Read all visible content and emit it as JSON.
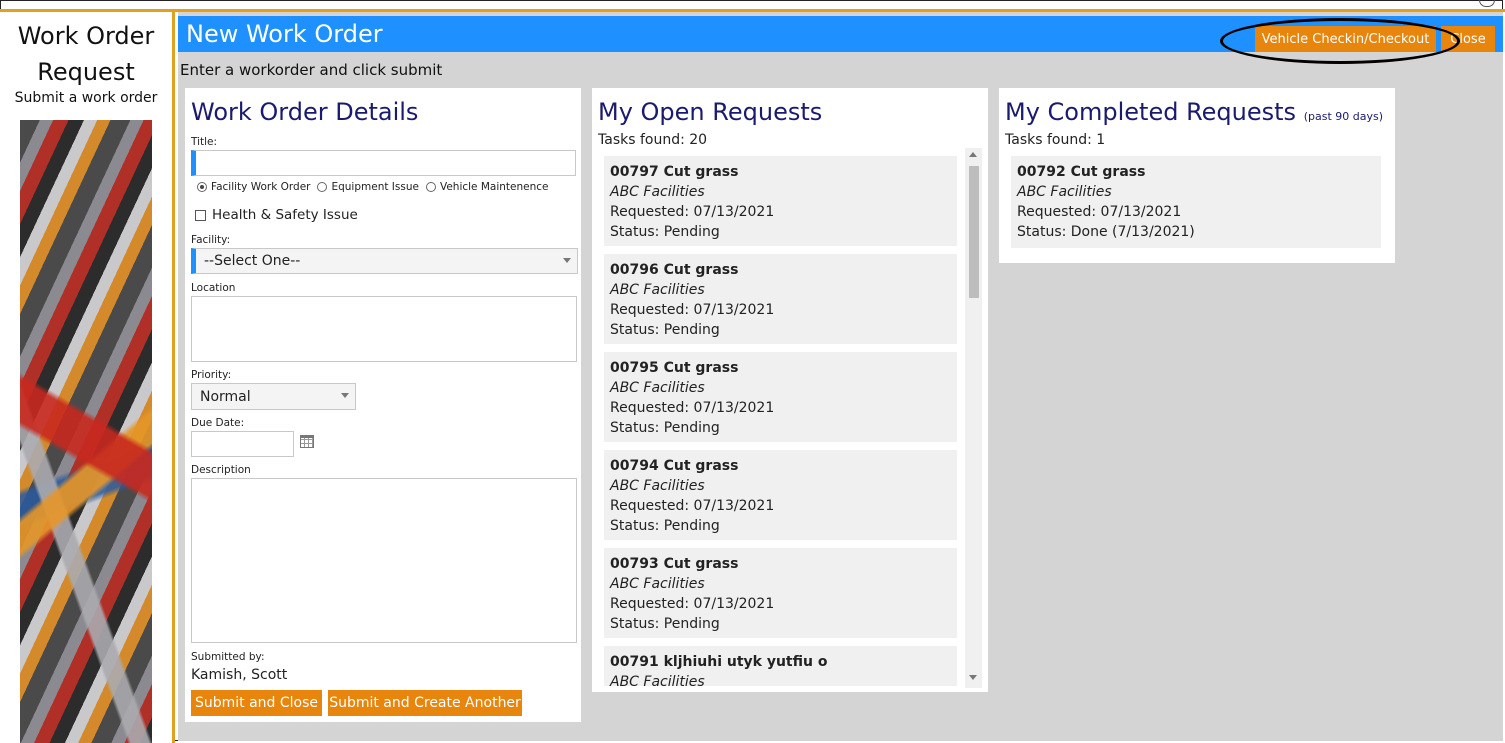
{
  "sidebar": {
    "title_line1": "Work Order",
    "title_line2": "Request",
    "subtitle": "Submit a work order",
    "image_alt": "tools-image"
  },
  "header": {
    "title": "New Work Order",
    "vehicle_button": "Vehicle Checkin/Checkout",
    "close_button": "Close",
    "accent_color": "#1e90ff",
    "button_color": "#e8850c"
  },
  "instruction": "Enter a workorder and click submit",
  "details": {
    "title": "Work Order Details",
    "title_label": "Title:",
    "title_value": "",
    "types": [
      "Facility Work Order",
      "Equipment Issue",
      "Vehicle Maintenence"
    ],
    "selected_type": "Facility Work Order",
    "health_safety_label": "Health & Safety Issue",
    "facility_label": "Facility:",
    "facility_value": "--Select One--",
    "location_label": "Location",
    "priority_label": "Priority:",
    "priority_value": "Normal",
    "due_date_label": "Due Date:",
    "due_date_value": "",
    "description_label": "Description",
    "submitted_by_label": "Submitted by:",
    "submitted_by_value": "Kamish, Scott",
    "submit_close": "Submit and Close",
    "submit_another": "Submit and Create Another"
  },
  "open": {
    "title": "My Open Requests",
    "tasks_found": "Tasks found: 20",
    "items": [
      {
        "title": "00797  Cut grass",
        "facility": "ABC Facilities",
        "requested": "Requested: 07/13/2021",
        "status": "Status: Pending"
      },
      {
        "title": "00796  Cut grass",
        "facility": "ABC Facilities",
        "requested": "Requested: 07/13/2021",
        "status": "Status: Pending"
      },
      {
        "title": "00795  Cut grass",
        "facility": "ABC Facilities",
        "requested": "Requested: 07/13/2021",
        "status": "Status: Pending"
      },
      {
        "title": "00794  Cut grass",
        "facility": "ABC Facilities",
        "requested": "Requested: 07/13/2021",
        "status": "Status: Pending"
      },
      {
        "title": "00793  Cut grass",
        "facility": "ABC Facilities",
        "requested": "Requested: 07/13/2021",
        "status": "Status: Pending"
      },
      {
        "title": "00791  kljhiuhi utyk yutfiu o",
        "facility": "ABC Facilities",
        "requested": "",
        "status": ""
      }
    ]
  },
  "completed": {
    "title": "My Completed Requests",
    "title_note": "(past 90 days)",
    "tasks_found": "Tasks found: 1",
    "items": [
      {
        "title": "00792  Cut grass",
        "facility": "ABC Facilities",
        "requested": "Requested: 07/13/2021",
        "status": "Status: Done (7/13/2021)"
      }
    ]
  }
}
